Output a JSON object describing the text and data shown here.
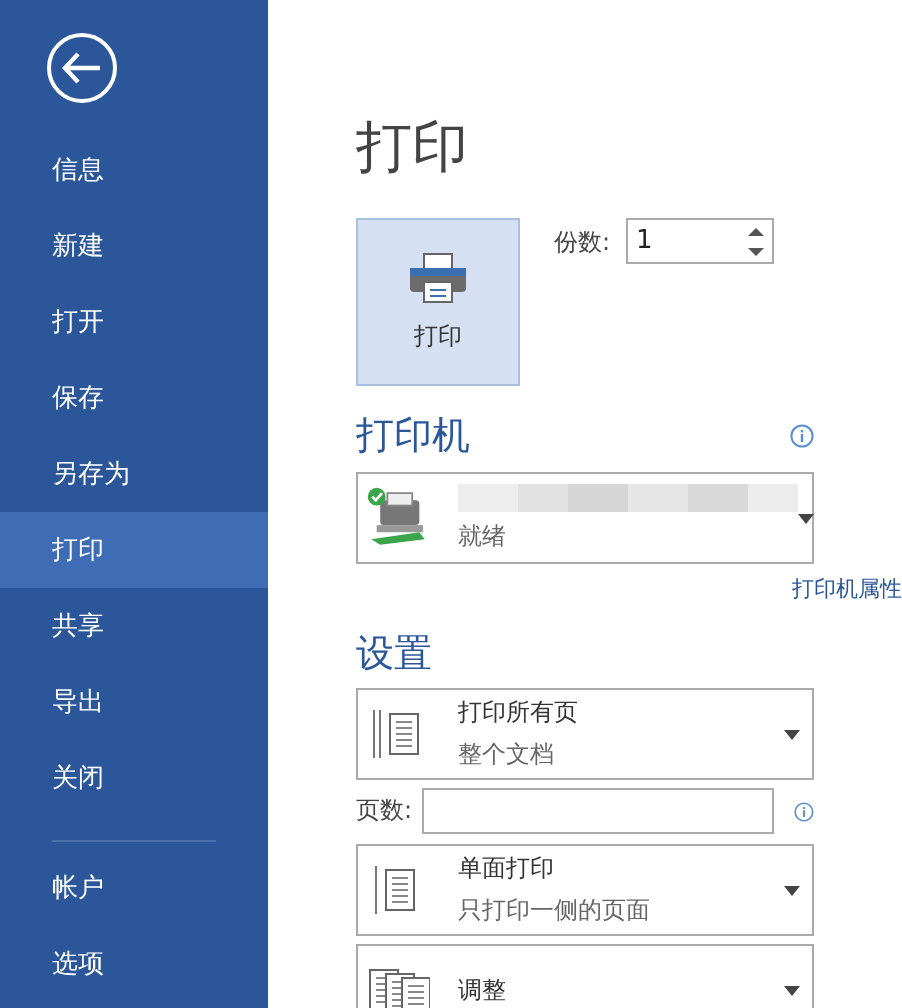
{
  "sidebar": {
    "items": [
      {
        "label": "信息",
        "selected": false
      },
      {
        "label": "新建",
        "selected": false
      },
      {
        "label": "打开",
        "selected": false
      },
      {
        "label": "保存",
        "selected": false
      },
      {
        "label": "另存为",
        "selected": false
      },
      {
        "label": "打印",
        "selected": true
      },
      {
        "label": "共享",
        "selected": false
      },
      {
        "label": "导出",
        "selected": false
      },
      {
        "label": "关闭",
        "selected": false
      }
    ],
    "bottom_items": [
      {
        "label": "帐户",
        "selected": false
      },
      {
        "label": "选项",
        "selected": false
      }
    ]
  },
  "title": "打印",
  "print_button": {
    "label": "打印"
  },
  "copies": {
    "label": "份数:",
    "value": "1"
  },
  "printer": {
    "heading": "打印机",
    "status": "就绪",
    "properties_link": "打印机属性"
  },
  "settings": {
    "heading": "设置",
    "items": [
      {
        "kind": "dropdown",
        "title": "打印所有页",
        "subtitle": "整个文档"
      },
      {
        "kind": "field",
        "label": "页数:"
      },
      {
        "kind": "dropdown",
        "title": "单面打印",
        "subtitle": "只打印一侧的页面"
      },
      {
        "kind": "dropdown",
        "title": "调整"
      }
    ]
  }
}
